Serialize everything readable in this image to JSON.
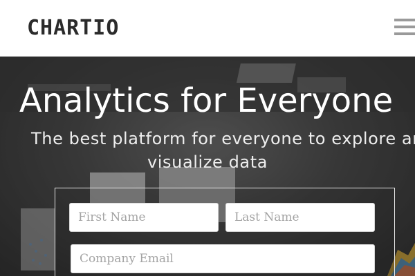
{
  "header": {
    "logo_text": "CHARTIO",
    "menu_icon": "hamburger-menu-icon"
  },
  "hero": {
    "headline": "Analytics for Everyone",
    "subheadline_line1": "The best platform for everyone to explore and",
    "subheadline_line2": "visualize data",
    "background_image": "office-dashboard-photo"
  },
  "signup_form": {
    "first_name_placeholder": "First Name",
    "last_name_placeholder": "Last Name",
    "company_email_placeholder": "Company Email"
  },
  "colors": {
    "logo": "#2b2b2b",
    "menu_icon": "#9a9a9a",
    "hero_text": "#ffffff"
  }
}
